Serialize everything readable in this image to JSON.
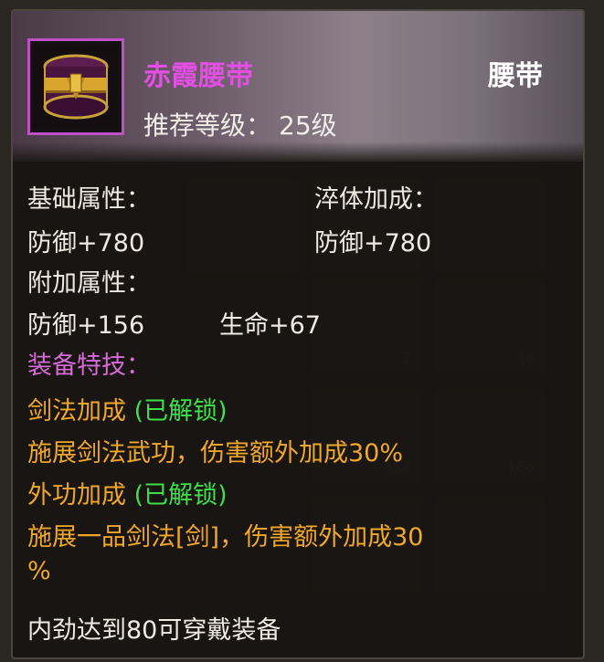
{
  "item": {
    "name": "赤霞腰带",
    "type": "腰带",
    "required_level_label": "推荐等级：",
    "required_level_value": "25级",
    "icon": "belt-icon",
    "rarity_color": "#e24fe2"
  },
  "base_attributes": {
    "label": "基础属性：",
    "stat": "防御+780"
  },
  "temper_bonus": {
    "label": "淬体加成：",
    "stat": "防御+780"
  },
  "extra_attributes": {
    "label": "附加属性：",
    "stats": [
      "防御+156",
      "生命+67"
    ]
  },
  "special_skills": {
    "label": "装备特技：",
    "skills": [
      {
        "name": "剑法加成",
        "status": "(已解锁)",
        "description": "施展剑法武功，伤害额外加成30%"
      },
      {
        "name": "外功加成",
        "status": "(已解锁)",
        "description_line1": "施展一品剑法[剑]，伤害额外加成30",
        "description_line2": "%"
      }
    ]
  },
  "requirement": "内劲达到80可穿戴装备",
  "background_counts": [
    "2",
    "38",
    "654",
    "166"
  ],
  "colors": {
    "white": "#efeae4",
    "purple": "#d66bd6",
    "orange": "#f0a72a",
    "green": "#3fe04a"
  }
}
